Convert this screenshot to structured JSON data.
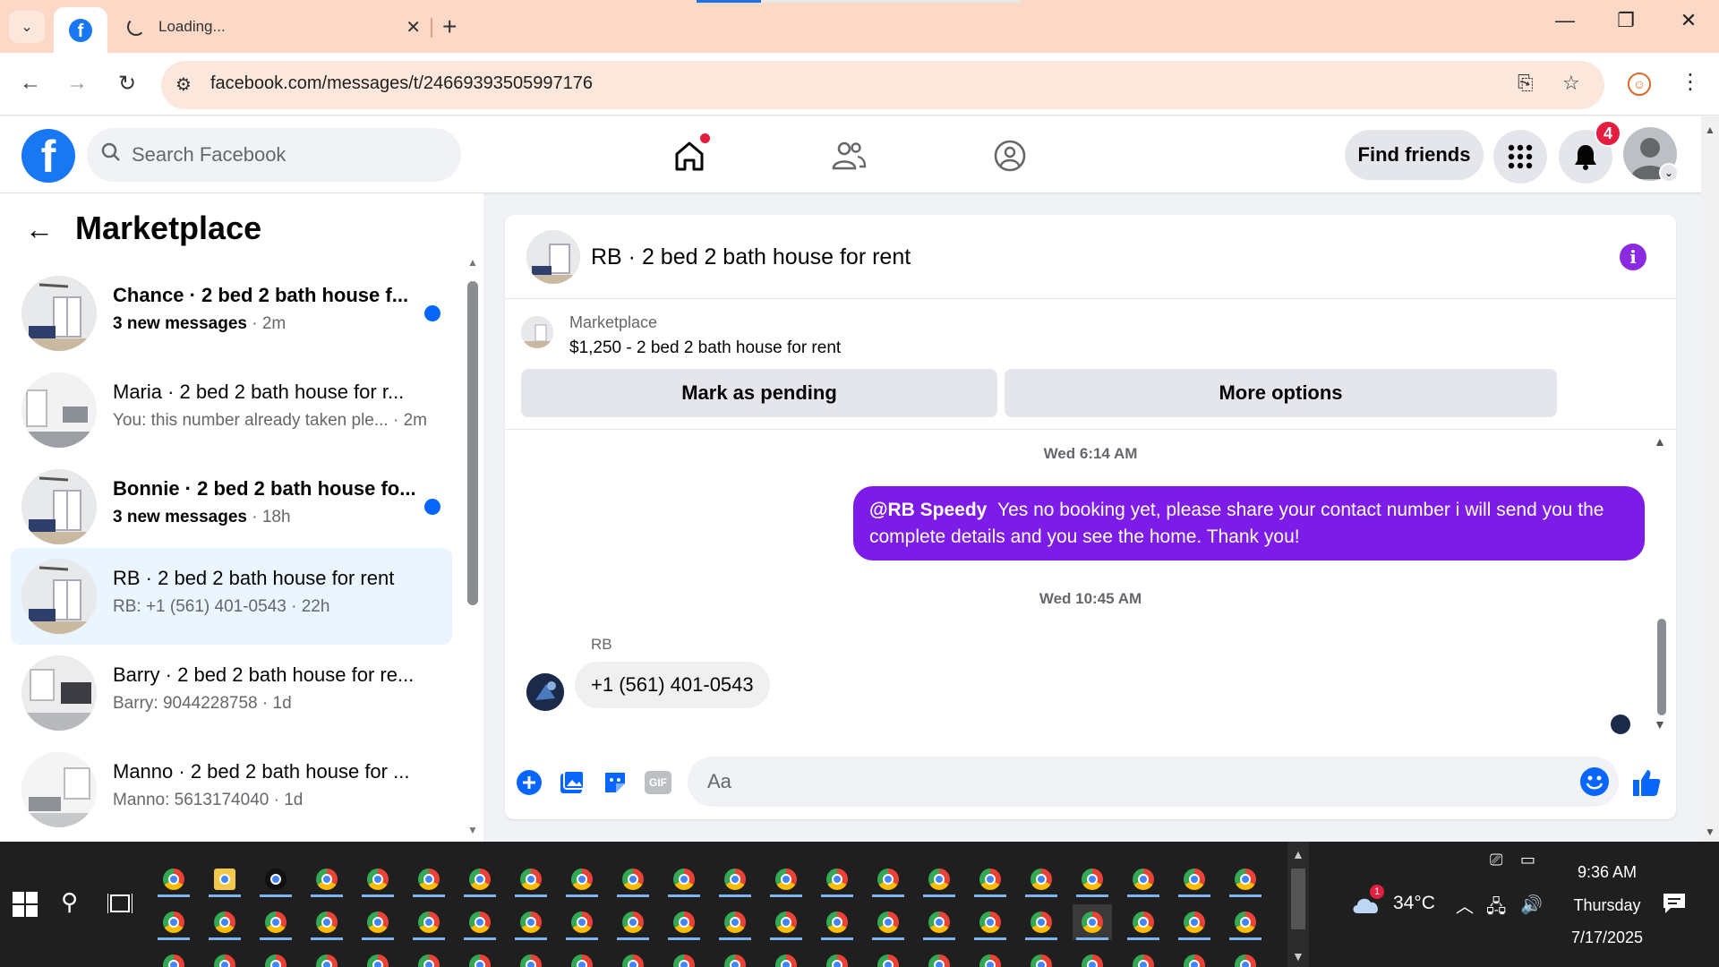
{
  "browser": {
    "tab_title": "Loading...",
    "new_tab": "+",
    "url": "facebook.com/messages/t/24669393505997176"
  },
  "fb_header": {
    "logo": "f",
    "search_placeholder": "Search Facebook",
    "find_friends": "Find friends",
    "notifications_count": "4"
  },
  "sidebar": {
    "title": "Marketplace",
    "conversations": [
      {
        "name": "Chance · 2 bed 2 bath house f...",
        "sub_bold": "3 new messages",
        "sub": " · 2m",
        "unread": true
      },
      {
        "name": "Maria · 2 bed 2 bath house for r...",
        "sub_bold": "",
        "sub": "You: this number already taken ple... · 2m",
        "unread": false
      },
      {
        "name": "Bonnie · 2 bed 2 bath house fo...",
        "sub_bold": "3 new messages",
        "sub": " · 18h",
        "unread": true
      },
      {
        "name": "RB · 2 bed 2 bath house for rent",
        "sub_bold": "",
        "sub": "RB: +1 (561) 401-0543 · 22h",
        "unread": false
      },
      {
        "name": "Barry · 2 bed 2 bath house for re...",
        "sub_bold": "",
        "sub": "Barry: 9044228758 · 1d",
        "unread": false
      },
      {
        "name": "Manno · 2 bed 2 bath house for ...",
        "sub_bold": "",
        "sub": "Manno: 5613174040 · 1d",
        "unread": false
      }
    ]
  },
  "chat": {
    "title": "RB · 2 bed 2 bath house for rent",
    "listing_source": "Marketplace",
    "listing_desc": "$1,250 - 2 bed 2 bath house for rent",
    "mark_pending": "Mark as pending",
    "more_options": "More options",
    "ts1": "Wed 6:14 AM",
    "out_mention": "@RB Speedy",
    "out_text": "Yes no booking yet, please share your contact number i will send you the complete details and you see the home. Thank you!",
    "ts2": "Wed 10:45 AM",
    "sender": "RB",
    "in_text": "+1 (561) 401-0543",
    "composer_placeholder": "Aa",
    "gif_label": "GIF"
  },
  "taskbar": {
    "weather_badge": "1",
    "temperature": "34°C",
    "time": "9:36 AM",
    "day": "Thursday",
    "date": "7/17/2025"
  },
  "colors": {
    "fb_blue": "#1877f2",
    "unread_blue": "#0866ff",
    "outgoing_bubble": "#7d1ce8",
    "tab_strip": "#fcd9c7",
    "notification_red": "#e41e3f"
  }
}
